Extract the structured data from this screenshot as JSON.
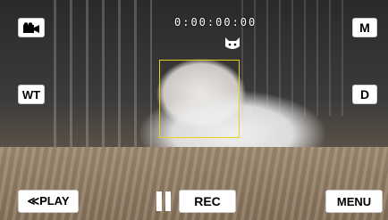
{
  "osd": {
    "top_left_icon": "video-camera-icon",
    "mode_label": "M",
    "wt_label": "WT",
    "d_label": "D",
    "play_label": "≪PLAY",
    "rec_label": "REC",
    "menu_label": "MENU",
    "pause_icon": "pause-icon",
    "face_detect_icon": "cat-face-icon",
    "counter_text": "0:00:00:00"
  },
  "colors": {
    "button_bg": "#ffffff",
    "button_text": "#000000",
    "face_box": "#e8d21a"
  }
}
